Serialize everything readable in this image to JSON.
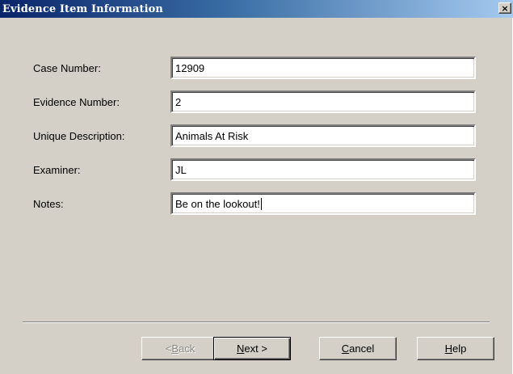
{
  "window": {
    "title": "Evidence Item Information",
    "close_label": "×"
  },
  "form": {
    "case_number": {
      "label": "Case Number:",
      "value": "12909"
    },
    "evidence_number": {
      "label": "Evidence Number:",
      "value": "2"
    },
    "unique_description": {
      "label": "Unique Description:",
      "value": "Animals At Risk"
    },
    "examiner": {
      "label": "Examiner:",
      "value": "JL"
    },
    "notes": {
      "label": "Notes:",
      "value": "Be on the lookout!"
    }
  },
  "buttons": {
    "back": {
      "prefix": "< ",
      "mnemonic": "B",
      "rest": "ack",
      "enabled": false
    },
    "next": {
      "mnemonic": "N",
      "rest": "ext >",
      "enabled": true
    },
    "cancel": {
      "mnemonic": "C",
      "rest": "ancel",
      "enabled": true
    },
    "help": {
      "mnemonic": "H",
      "rest": "elp",
      "enabled": true
    }
  },
  "colors": {
    "dialog_bg": "#d4d0c8",
    "titlebar_start": "#0a246a",
    "titlebar_end": "#a6caf0",
    "disabled_text": "#8c8a84"
  }
}
